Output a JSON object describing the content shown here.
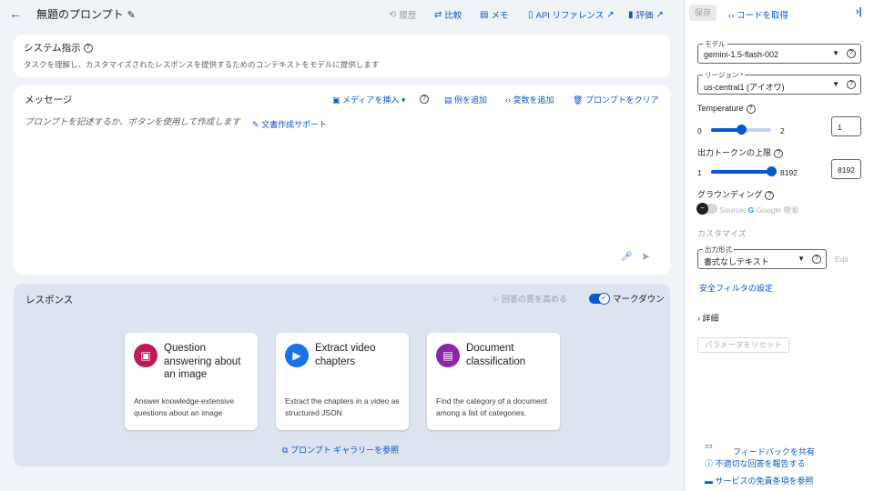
{
  "header": {
    "title": "無題のプロンプト",
    "history": "履歴",
    "compare": "比較",
    "notes": "メモ",
    "api_ref": "API リファレンス",
    "eval": "評価"
  },
  "system": {
    "title": "システム指示",
    "description": "タスクを理解し、カスタマイズされたレスポンスを提供するためのコンテキストをモデルに提供します"
  },
  "message": {
    "title": "メッセージ",
    "insert_media": "メディアを挿入",
    "add_example": "例を追加",
    "add_variable": "変数を追加",
    "clear_prompt": "プロンプトをクリア",
    "placeholder": "プロンプトを記述するか、ボタンを使用して作成します",
    "writing_assist": "文書作成サポート"
  },
  "response": {
    "title": "レスポンス",
    "improve": "回答の質を高める",
    "markdown": "マークダウン",
    "samples": [
      {
        "title": "Question answering about an image",
        "desc": "Answer knowledge-extensive questions about an image",
        "color": "#c2185b",
        "icon": "image-icon"
      },
      {
        "title": "Extract video chapters",
        "desc": "Extract the chapters in a video as structured JSON",
        "color": "#1a73e8",
        "icon": "video-icon"
      },
      {
        "title": "Document classification",
        "desc": "Find the category of a document among a list of categories.",
        "color": "#8e24aa",
        "icon": "document-icon"
      }
    ],
    "gallery": "プロンプト ギャラリーを参照"
  },
  "sidebar": {
    "save": "保存",
    "get_code": "コードを取得",
    "model_label": "モデル",
    "model_value": "gemini-1.5-flash-002",
    "region_label": "リージョン *",
    "region_value": "us-central1 (アイオワ)",
    "temperature_label": "Temperature",
    "temperature_min": "0",
    "temperature_max": "2",
    "temperature_value": "1",
    "temperature_fraction": 0.5,
    "tokens_label": "出力トークンの上限",
    "tokens_min": "1",
    "tokens_max": "8192",
    "tokens_value": "8192",
    "tokens_fraction": 1.0,
    "grounding_label": "グラウンディング",
    "grounding_source": "Source:",
    "grounding_google": "Google 検索",
    "customize": "カスタマイズ",
    "output_format_label": "出力形式",
    "output_format_value": "書式なしテキスト",
    "edit": "Edit",
    "safety_filter": "安全フィルタの設定",
    "details": "詳細",
    "reset": "パラメータをリセット",
    "feedback": "フィードバックを共有",
    "report": "不適切な回答を報告する",
    "disclaimer": "サービスの免責条項を参照"
  }
}
